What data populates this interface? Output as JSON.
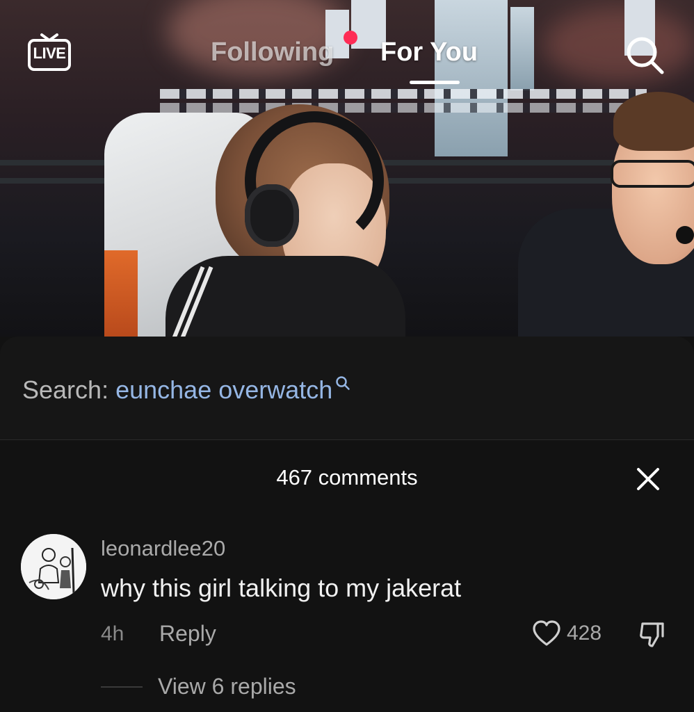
{
  "top_nav": {
    "live_label": "LIVE",
    "tabs": [
      {
        "label": "Following",
        "active": false,
        "has_notification_dot": true
      },
      {
        "label": "For You",
        "active": true
      }
    ],
    "icons": {
      "live": "live-tv-icon",
      "search": "search-icon"
    }
  },
  "search_suggestion": {
    "prefix": "Search:",
    "query": "eunchae overwatch",
    "icon": "search-mini-icon"
  },
  "comments_sheet": {
    "count_label": "467 comments",
    "close_icon": "close-icon",
    "comments": [
      {
        "username": "leonardlee20",
        "text": "why this girl talking to my jakerat",
        "time": "4h",
        "reply_label": "Reply",
        "likes": "428",
        "view_replies_label": "View 6 replies",
        "icons": {
          "like": "heart-outline-icon",
          "dislike": "thumbs-down-icon"
        }
      }
    ]
  },
  "colors": {
    "background": "#121212",
    "search_query": "#95b6e4",
    "notification_dot": "#fe2c55",
    "secondary_text": "#a9a9a9"
  }
}
